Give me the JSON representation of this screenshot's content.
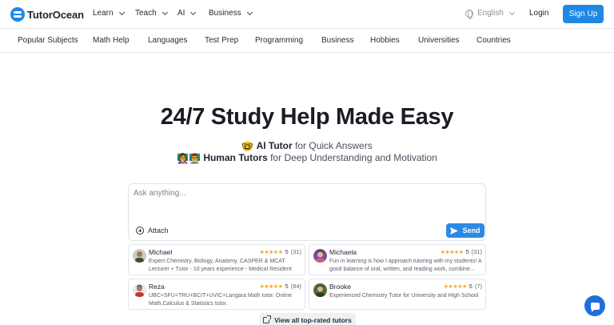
{
  "header": {
    "brand": "TutorOcean",
    "menus": [
      {
        "label": "Learn"
      },
      {
        "label": "Teach"
      },
      {
        "label": "AI"
      },
      {
        "label": "Business"
      }
    ],
    "language": "English",
    "login": "Login",
    "signup": "Sign Up",
    "accent": "#1e88e5"
  },
  "subjects": [
    "Popular Subjects",
    "Math Help",
    "Languages",
    "Test Prep",
    "Programming",
    "Business",
    "Hobbies",
    "Universities",
    "Countries"
  ],
  "hero": {
    "title": "24/7 Study Help Made Easy",
    "ai_emoji": "🤓",
    "ai_strong": "AI Tutor",
    "ai_rest": " for Quick Answers",
    "human_emoji": "👩‍🏫👨‍🏫",
    "human_strong": "Human Tutors",
    "human_rest": " for Deep Understanding and Motivation"
  },
  "ask": {
    "placeholder": "Ask anything...",
    "attach": "Attach",
    "send": "Send"
  },
  "tutors": [
    {
      "name": "Michael",
      "rating": "5",
      "count": "(31)",
      "desc": "Expert Chemistry, Biology, Anatomy, CASPER & MCAT Lecturer + Tutor - 10 years experience - Medical Resident"
    },
    {
      "name": "Michaela",
      "rating": "5",
      "count": "(31)",
      "desc": "Fun in learning is how I approach tutoring with my students! A good balance of oral, written, and reading work, combine..."
    },
    {
      "name": "Reza",
      "rating": "5",
      "count": "(84)",
      "desc": "UBC+SFU+TRU+BCIT+UVIC+Langara Math tutor. Online Math,Calculus & Statistics tutor."
    },
    {
      "name": "Brooke",
      "rating": "5",
      "count": "(7)",
      "desc": "Experienced Chemistry Tutor for University and High School"
    }
  ],
  "stars": "★★★★★",
  "view_all": "View all top-rated tutors"
}
